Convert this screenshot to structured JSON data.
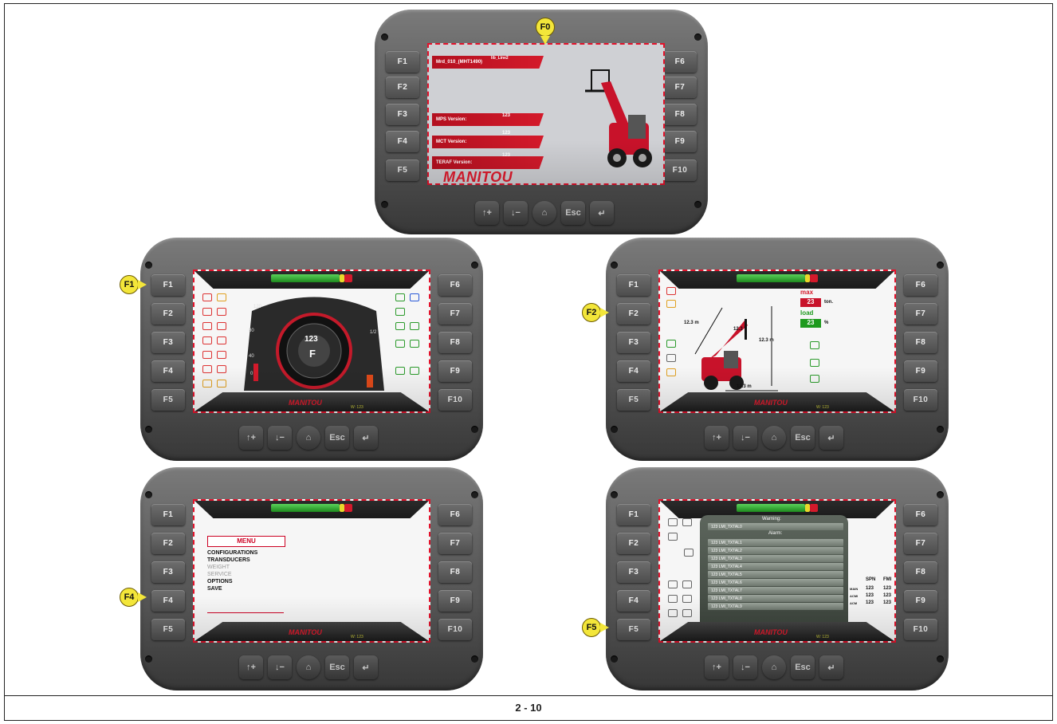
{
  "page": {
    "number": "2 - 10"
  },
  "device": {
    "fkeys_left": [
      "F1",
      "F2",
      "F3",
      "F4",
      "F5"
    ],
    "fkeys_right": [
      "F6",
      "F7",
      "F8",
      "F9",
      "F10"
    ],
    "nav": {
      "esc": "Esc",
      "enter": "↵",
      "up": "↑+",
      "down": "↓−",
      "home": "⌂"
    }
  },
  "callouts": {
    "f0": "F0",
    "f1": "F1",
    "f2": "F2",
    "f4": "F4",
    "f5": "F5"
  },
  "screen_f0": {
    "row1": "Mrd_010_(MHT1490)",
    "row1_tag": "lib_Line2",
    "mps_label": "MPS Version:",
    "mps_value": "123",
    "mct_label": "MCT Version:",
    "mct_value": "123",
    "teraf_label": "TERAF Version:",
    "teraf_value": "123",
    "brand": "MANITOU"
  },
  "screen_f1": {
    "speed_value": "123",
    "gear": "F",
    "scale": [
      "120",
      "80",
      "40",
      "0"
    ],
    "scale_right": "1/2",
    "brand": "MANITOU",
    "version": "W: 123"
  },
  "screen_f2": {
    "max_label": "max",
    "max_value": "23",
    "max_unit": "ton.",
    "load_label": "load",
    "load_value": "23",
    "load_unit": "%",
    "reach": "12.3 m",
    "height": "12.3 m",
    "angle": "12.3 °",
    "base": "12.3 m",
    "brand": "MANITOU",
    "version": "W: 123"
  },
  "screen_f4": {
    "title": "MENU",
    "items": [
      "CONFIGURATIONS",
      "TRANSDUCERS",
      "WEIGHT",
      "SERVICE",
      "OPTIONS",
      "SAVE"
    ],
    "brand": "MANITOU",
    "version": "W: 123"
  },
  "screen_f5": {
    "warning": "Warning:",
    "alarm": "Alarm:",
    "rows": [
      "123  LMI_TXTAL0",
      "123  LMI_TXTAL1",
      "123  LMI_TXTAL2",
      "123  LMI_TXTAL3",
      "123  LMI_TXTAL4",
      "123  LMI_TXTAL5",
      "123  LMI_TXTAL6",
      "123  LMI_TXTAL7",
      "123  LMI_TXTAL8",
      "123  LMI_TXTAL9"
    ],
    "spn": "SPN",
    "fmi": "FMI",
    "codes": [
      [
        "MAIN",
        "123",
        "123"
      ],
      [
        "ACMI",
        "123",
        "123"
      ],
      [
        "ACM",
        "123",
        "123"
      ]
    ],
    "brand": "MANITOU",
    "version": "W: 123"
  }
}
